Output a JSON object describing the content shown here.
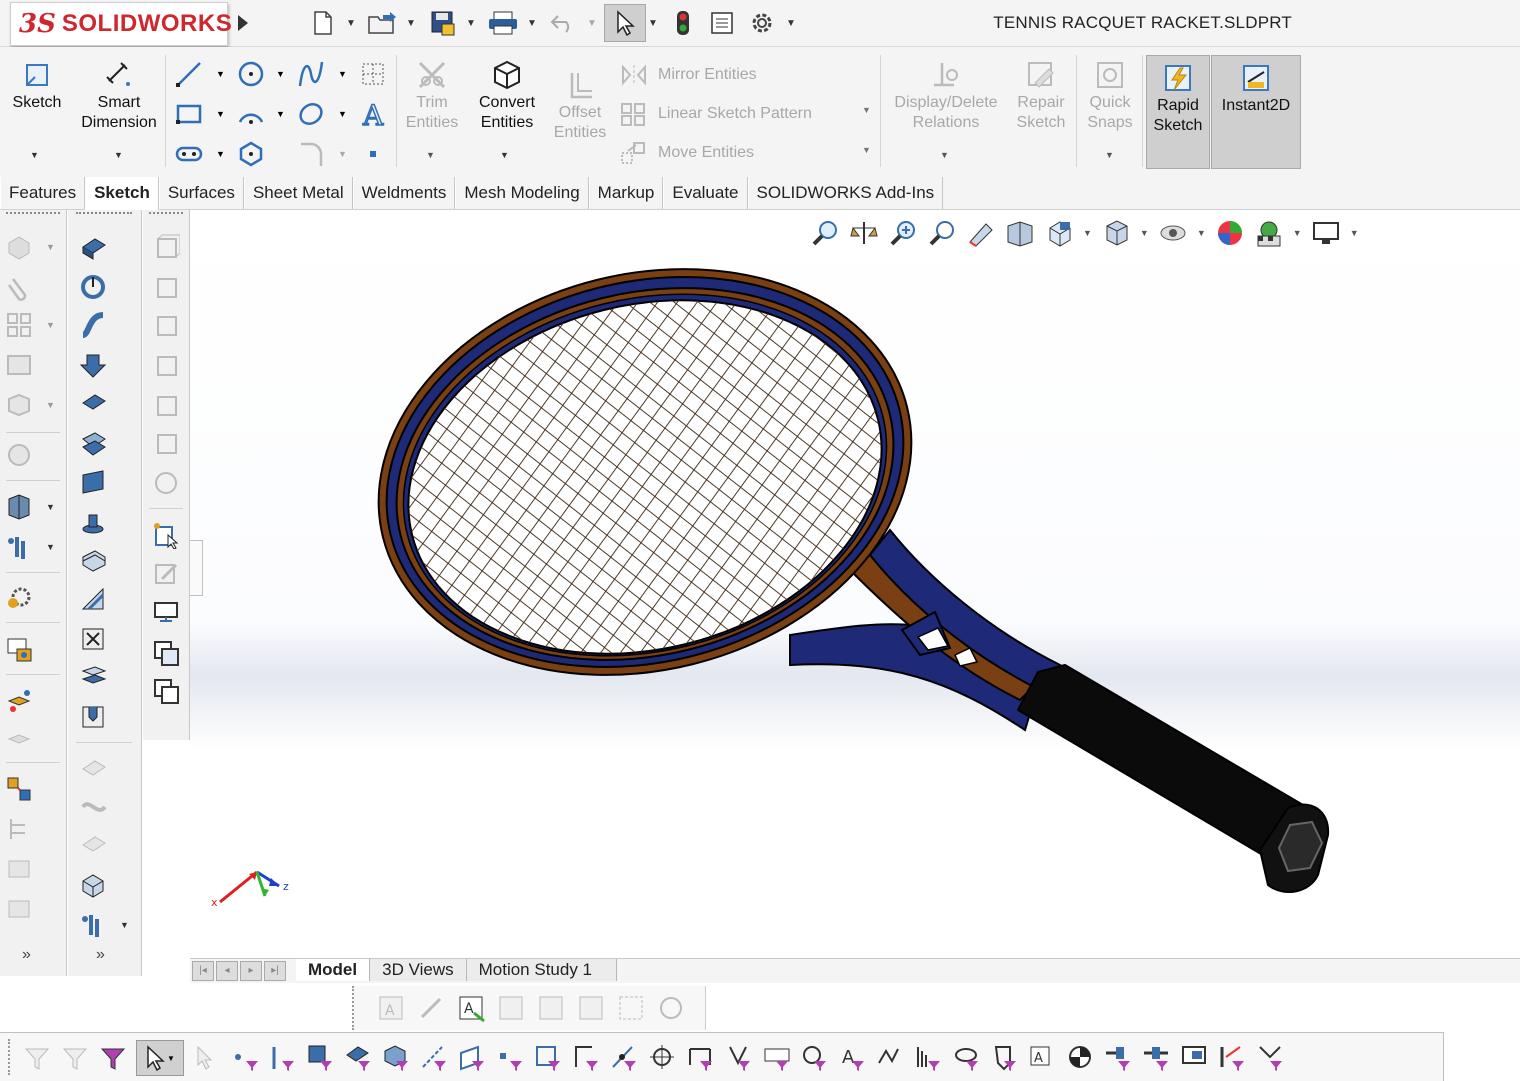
{
  "app": {
    "brand": "SOLIDWORKS",
    "brand_prefix": "3S",
    "document_title": "TENNIS RACQUET RACKET.SLDPRT"
  },
  "command_manager": {
    "sketch": "Sketch",
    "smart_dimension_line1": "Smart",
    "smart_dimension_line2": "Dimension",
    "trim_line1": "Trim",
    "trim_line2": "Entities",
    "convert_line1": "Convert",
    "convert_line2": "Entities",
    "offset_line1": "Offset",
    "offset_line2": "Entities",
    "mirror_entities": "Mirror Entities",
    "linear_sketch_pattern": "Linear Sketch Pattern",
    "move_entities": "Move Entities",
    "display_delete_line1": "Display/Delete",
    "display_delete_line2": "Relations",
    "repair_line1": "Repair",
    "repair_line2": "Sketch",
    "quick_snaps_line1": "Quick",
    "quick_snaps_line2": "Snaps",
    "rapid_sketch_line1": "Rapid",
    "rapid_sketch_line2": "Sketch",
    "instant2d": "Instant2D"
  },
  "tabs": [
    {
      "label": "Features",
      "selected": false
    },
    {
      "label": "Sketch",
      "selected": true
    },
    {
      "label": "Surfaces",
      "selected": false
    },
    {
      "label": "Sheet Metal",
      "selected": false
    },
    {
      "label": "Weldments",
      "selected": false
    },
    {
      "label": "Mesh Modeling",
      "selected": false
    },
    {
      "label": "Markup",
      "selected": false
    },
    {
      "label": "Evaluate",
      "selected": false
    },
    {
      "label": "SOLIDWORKS Add-Ins",
      "selected": false
    }
  ],
  "bottom_tabs": {
    "model": "Model",
    "views_3d": "3D Views",
    "motion_study": "Motion Study 1"
  },
  "triad": {
    "z_label": "z",
    "x_label": "x"
  },
  "colors": {
    "brand_red": "#d0262d",
    "racket_brown": "#7a3f12",
    "racket_blue": "#1e2a78",
    "grip_black": "#0b0b0b"
  }
}
